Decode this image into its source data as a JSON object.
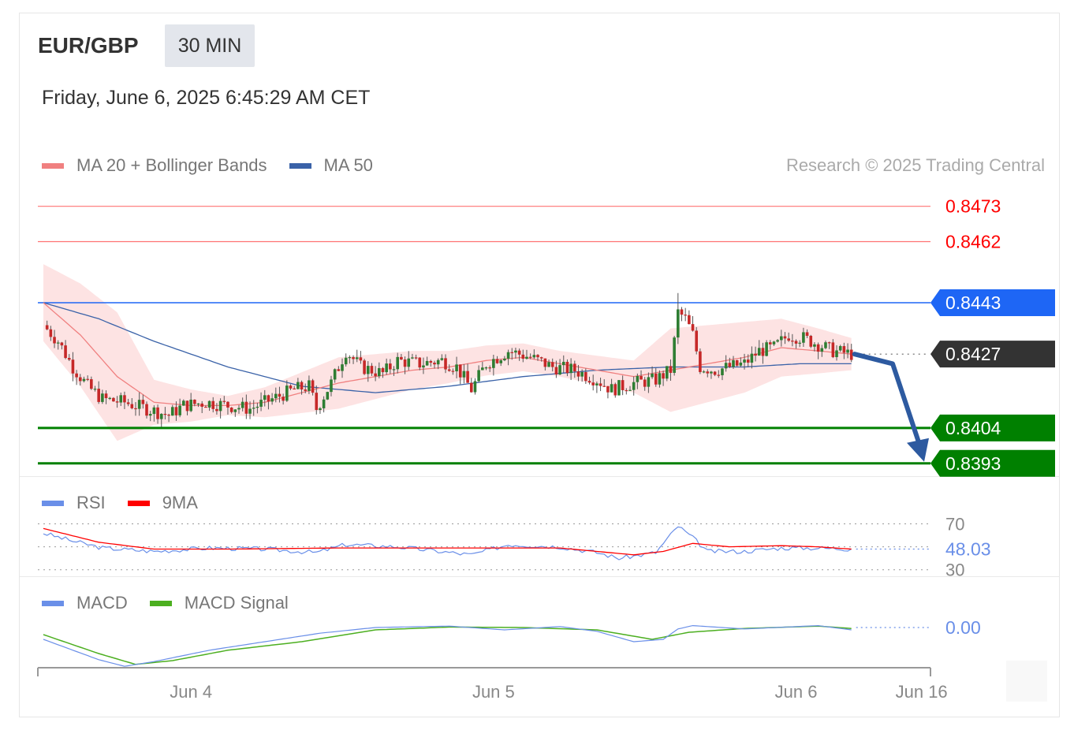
{
  "header": {
    "pair": "EUR/GBP",
    "timeframe": "30 MIN",
    "datetime": "Friday, June 6, 2025 6:45:29 AM CET",
    "copyright": "Research © 2025 Trading Central"
  },
  "colors": {
    "ma20": "#f08080",
    "ma50": "#3a62a8",
    "band": "#fde3e3",
    "resistance": "#ff0000",
    "pivot": "#1e66f5",
    "current": "#333333",
    "support": "#008000",
    "arrow": "#2d5aa0",
    "bull": "#2e7d32",
    "bear": "#c62828",
    "rsi": "#6a8fe8",
    "rsi_ma": "#ff0000",
    "macd": "#6a8fe8",
    "macd_signal": "#4caf20"
  },
  "chart_data": [
    {
      "type": "candlestick",
      "name": "price",
      "legend": [
        {
          "label": "MA 20 + Bollinger Bands",
          "color": "#f08080"
        },
        {
          "label": "MA 50",
          "color": "#3a62a8"
        }
      ],
      "ylim": [
        0.839,
        0.8482
      ],
      "levels": [
        {
          "value": 0.8473,
          "label": "0.8473",
          "kind": "resistance"
        },
        {
          "value": 0.8462,
          "label": "0.8462",
          "kind": "resistance"
        },
        {
          "value": 0.8443,
          "label": "0.8443",
          "kind": "pivot"
        },
        {
          "value": 0.8427,
          "label": "0.8427",
          "kind": "current"
        },
        {
          "value": 0.8404,
          "label": "0.8404",
          "kind": "support"
        },
        {
          "value": 0.8393,
          "label": "0.8393",
          "kind": "support"
        }
      ],
      "forecast_arrow": {
        "from": 0.8427,
        "to": 0.8393
      },
      "close_anchors": [
        [
          0,
          0.8436
        ],
        [
          4,
          0.8431
        ],
        [
          8,
          0.8423
        ],
        [
          12,
          0.8417
        ],
        [
          16,
          0.8413
        ],
        [
          22,
          0.8412
        ],
        [
          28,
          0.841
        ],
        [
          34,
          0.8408
        ],
        [
          38,
          0.8411
        ],
        [
          44,
          0.8412
        ],
        [
          50,
          0.8411
        ],
        [
          56,
          0.841
        ],
        [
          62,
          0.8413
        ],
        [
          68,
          0.8416
        ],
        [
          72,
          0.8417
        ],
        [
          74,
          0.841
        ],
        [
          78,
          0.8418
        ],
        [
          82,
          0.8428
        ],
        [
          86,
          0.8423
        ],
        [
          92,
          0.8421
        ],
        [
          96,
          0.8425
        ],
        [
          102,
          0.8424
        ],
        [
          108,
          0.8425
        ],
        [
          112,
          0.8423
        ],
        [
          116,
          0.8416
        ],
        [
          120,
          0.8424
        ],
        [
          126,
          0.8428
        ],
        [
          132,
          0.8426
        ],
        [
          138,
          0.8423
        ],
        [
          144,
          0.8422
        ],
        [
          150,
          0.8419
        ],
        [
          154,
          0.8416
        ],
        [
          160,
          0.8418
        ],
        [
          166,
          0.8419
        ],
        [
          170,
          0.8422
        ],
        [
          172,
          0.844
        ],
        [
          174,
          0.8438
        ],
        [
          176,
          0.8433
        ],
        [
          178,
          0.8423
        ],
        [
          182,
          0.8422
        ],
        [
          186,
          0.8423
        ],
        [
          190,
          0.8424
        ],
        [
          194,
          0.8428
        ],
        [
          198,
          0.8429
        ],
        [
          202,
          0.8433
        ],
        [
          206,
          0.8432
        ],
        [
          210,
          0.843
        ],
        [
          214,
          0.8428
        ],
        [
          219,
          0.8427
        ]
      ],
      "ma20_anchors": [
        [
          0,
          0.8443
        ],
        [
          10,
          0.8433
        ],
        [
          20,
          0.842
        ],
        [
          30,
          0.8412
        ],
        [
          40,
          0.8411
        ],
        [
          50,
          0.8411
        ],
        [
          60,
          0.8412
        ],
        [
          70,
          0.8415
        ],
        [
          80,
          0.8418
        ],
        [
          90,
          0.842
        ],
        [
          100,
          0.8422
        ],
        [
          110,
          0.8423
        ],
        [
          120,
          0.8425
        ],
        [
          130,
          0.8426
        ],
        [
          140,
          0.8424
        ],
        [
          150,
          0.8422
        ],
        [
          160,
          0.842
        ],
        [
          170,
          0.8422
        ],
        [
          180,
          0.8424
        ],
        [
          190,
          0.8426
        ],
        [
          200,
          0.8429
        ],
        [
          210,
          0.8428
        ],
        [
          219,
          0.8427
        ]
      ],
      "band_width_anchors": [
        [
          0,
          0.0012
        ],
        [
          20,
          0.002
        ],
        [
          30,
          0.0007
        ],
        [
          50,
          0.0003
        ],
        [
          80,
          0.0008
        ],
        [
          110,
          0.0005
        ],
        [
          140,
          0.0004
        ],
        [
          160,
          0.0005
        ],
        [
          170,
          0.0013
        ],
        [
          190,
          0.0011
        ],
        [
          210,
          0.0007
        ],
        [
          219,
          0.0005
        ]
      ],
      "ma50_anchors": [
        [
          0,
          0.8443
        ],
        [
          15,
          0.8438
        ],
        [
          30,
          0.8431
        ],
        [
          50,
          0.8423
        ],
        [
          70,
          0.8417
        ],
        [
          90,
          0.8415
        ],
        [
          110,
          0.8417
        ],
        [
          130,
          0.842
        ],
        [
          150,
          0.8422
        ],
        [
          170,
          0.8423
        ],
        [
          190,
          0.8423
        ],
        [
          205,
          0.8424
        ],
        [
          219,
          0.8424
        ]
      ],
      "spike": {
        "index": 172,
        "high": 0.8446
      }
    },
    {
      "type": "line",
      "name": "rsi",
      "legend": [
        {
          "label": "RSI",
          "color": "#6a8fe8"
        },
        {
          "label": "9MA",
          "color": "#ff0000"
        }
      ],
      "ylim": [
        25,
        80
      ],
      "levels": [
        70,
        30
      ],
      "level_labels": [
        "70",
        "30"
      ],
      "last_value": 48.03,
      "last_label": "48.03",
      "rsi_anchors": [
        [
          0,
          62
        ],
        [
          8,
          55
        ],
        [
          16,
          49
        ],
        [
          30,
          46
        ],
        [
          45,
          49
        ],
        [
          60,
          48
        ],
        [
          74,
          45
        ],
        [
          82,
          52
        ],
        [
          96,
          50
        ],
        [
          116,
          43
        ],
        [
          126,
          52
        ],
        [
          140,
          50
        ],
        [
          150,
          45
        ],
        [
          156,
          40
        ],
        [
          166,
          45
        ],
        [
          172,
          68
        ],
        [
          176,
          58
        ],
        [
          180,
          46
        ],
        [
          190,
          46
        ],
        [
          200,
          49
        ],
        [
          210,
          49
        ],
        [
          219,
          48.03
        ]
      ],
      "rsi_ma_anchors": [
        [
          0,
          66
        ],
        [
          15,
          54
        ],
        [
          30,
          48
        ],
        [
          50,
          48
        ],
        [
          80,
          49
        ],
        [
          110,
          49
        ],
        [
          140,
          49
        ],
        [
          160,
          43
        ],
        [
          168,
          46
        ],
        [
          176,
          53
        ],
        [
          186,
          50
        ],
        [
          200,
          51
        ],
        [
          210,
          50
        ],
        [
          219,
          48
        ]
      ]
    },
    {
      "type": "line",
      "name": "macd",
      "legend": [
        {
          "label": "MACD",
          "color": "#6a8fe8"
        },
        {
          "label": "MACD Signal",
          "color": "#4caf20"
        }
      ],
      "ylim": [
        -0.0009,
        0.00035
      ],
      "zero_label": "0.00",
      "macd_anchors": [
        [
          0,
          -0.00025
        ],
        [
          15,
          -0.00068
        ],
        [
          22,
          -0.00082
        ],
        [
          30,
          -0.00072
        ],
        [
          45,
          -0.00048
        ],
        [
          60,
          -0.0003
        ],
        [
          75,
          -0.00012
        ],
        [
          90,
          0.0
        ],
        [
          110,
          3e-05
        ],
        [
          125,
          -5e-05
        ],
        [
          140,
          2e-05
        ],
        [
          150,
          -8e-05
        ],
        [
          160,
          -0.0003
        ],
        [
          168,
          -0.00025
        ],
        [
          172,
          -3e-05
        ],
        [
          176,
          4e-05
        ],
        [
          190,
          -3e-05
        ],
        [
          210,
          4e-05
        ],
        [
          219,
          -5e-05
        ]
      ],
      "signal_anchors": [
        [
          0,
          -0.00015
        ],
        [
          15,
          -0.00055
        ],
        [
          25,
          -0.00078
        ],
        [
          35,
          -0.0007
        ],
        [
          50,
          -0.00048
        ],
        [
          70,
          -0.0003
        ],
        [
          90,
          -5e-05
        ],
        [
          110,
          1e-05
        ],
        [
          130,
          0.0
        ],
        [
          150,
          -5e-05
        ],
        [
          165,
          -0.00025
        ],
        [
          175,
          -0.0001
        ],
        [
          190,
          -2e-05
        ],
        [
          210,
          3e-05
        ],
        [
          219,
          -2e-05
        ]
      ]
    }
  ],
  "x_axis": {
    "ticks": [
      {
        "index": 40,
        "label": "Jun 4"
      },
      {
        "index": 122,
        "label": "Jun 5"
      },
      {
        "index": 204,
        "label": "Jun 6"
      },
      {
        "index": 238,
        "label": "Jun 16"
      }
    ],
    "max_index": 240,
    "last_candle_index": 219
  }
}
